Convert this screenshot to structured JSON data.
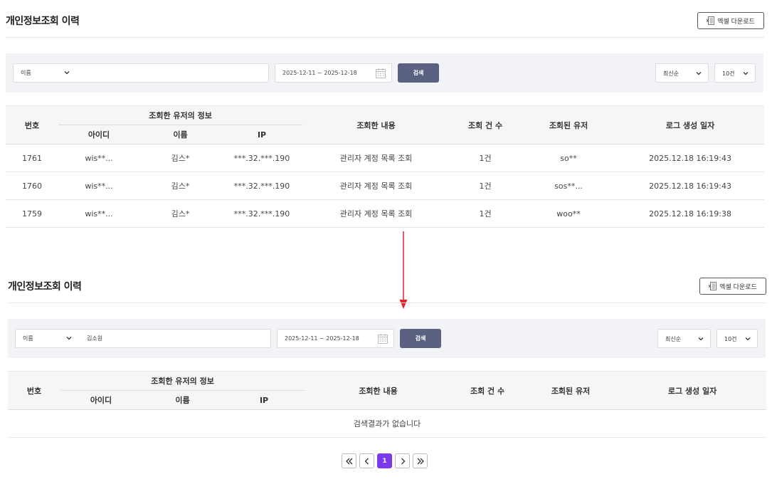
{
  "top": {
    "title": "개인정보조회 이력",
    "excel_label": "엑셀 다운로드",
    "search": {
      "keyword_type": "이름",
      "keyword_value": "",
      "date_range": "2025-12-11 ~ 2025-12-18",
      "search_label": "검색",
      "sort": "최신순",
      "page_size": "10건"
    },
    "table": {
      "headers": {
        "no": "번호",
        "group": "조회한 유저의 정보",
        "id": "아이디",
        "name": "이름",
        "ip": "IP",
        "content": "조회한 내용",
        "count": "조회 건 수",
        "target": "조회된 유저",
        "date": "로그 생성 일자"
      },
      "rows": [
        {
          "no": "1761",
          "id": "wis**...",
          "name": "김스*",
          "ip": "***.32.***.190",
          "content": "관리자 계정 목록 조회",
          "count": "1건",
          "target": "so**",
          "date": "2025.12.18 16:19:43"
        },
        {
          "no": "1760",
          "id": "wis**...",
          "name": "김스*",
          "ip": "***.32.***.190",
          "content": "관리자 계정 목록 조회",
          "count": "1건",
          "target": "sos**...",
          "date": "2025.12.18 16:19:43"
        },
        {
          "no": "1759",
          "id": "wis**...",
          "name": "김스*",
          "ip": "***.32.***.190",
          "content": "관리자 계정 목록 조회",
          "count": "1건",
          "target": "woo**",
          "date": "2025.12.18 16:19:38"
        }
      ]
    }
  },
  "bottom": {
    "title": "개인정보조회 이력",
    "excel_label": "엑셀 다운로드",
    "search": {
      "keyword_type": "이름",
      "keyword_value": "김소원",
      "date_range": "2025-12-11 ~ 2025-12-18",
      "search_label": "검색",
      "sort": "최신순",
      "page_size": "10건"
    },
    "table": {
      "headers": {
        "no": "번호",
        "group": "조회한 유저의 정보",
        "id": "아이디",
        "name": "이름",
        "ip": "IP",
        "content": "조회한 내용",
        "count": "조회 건 수",
        "target": "조회된 유저",
        "date": "로그 생성 일자"
      },
      "empty_message": "검색결과가 없습니다"
    },
    "pagination": {
      "current_page": "1"
    }
  },
  "colors": {
    "search_button": "#5b6180",
    "active_page": "#7c3aed",
    "arrow": "#e8202a"
  },
  "icons": [
    "excel-icon",
    "chevron-down-icon",
    "calendar-icon",
    "double-chevron-left-icon",
    "chevron-left-icon",
    "chevron-right-icon",
    "double-chevron-right-icon",
    "arrow-down-icon"
  ]
}
